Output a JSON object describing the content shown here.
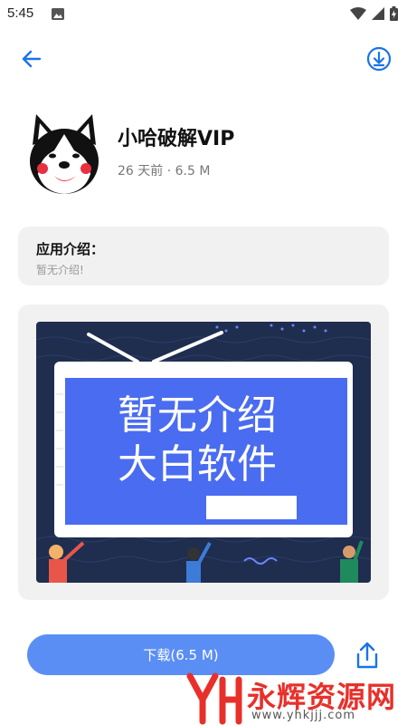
{
  "status_bar": {
    "time": "5:45"
  },
  "app": {
    "name": "小哈破解VIP",
    "meta": "26 天前 · 6.5 M"
  },
  "description": {
    "title": "应用介绍：",
    "body": "暂无介绍!"
  },
  "banner": {
    "line1": "暂无介绍",
    "line2": "大白软件"
  },
  "actions": {
    "download_label": "下载(6.5 M)"
  },
  "watermark": {
    "text": "永辉资源网",
    "url": "www.yhkjjj.com"
  },
  "colors": {
    "accent": "#5b8ef5",
    "icon_blue": "#1a73e8",
    "banner_bg": "#1f2d4f",
    "banner_screen": "#4a6cf0",
    "watermark_red": "#e8302a"
  }
}
